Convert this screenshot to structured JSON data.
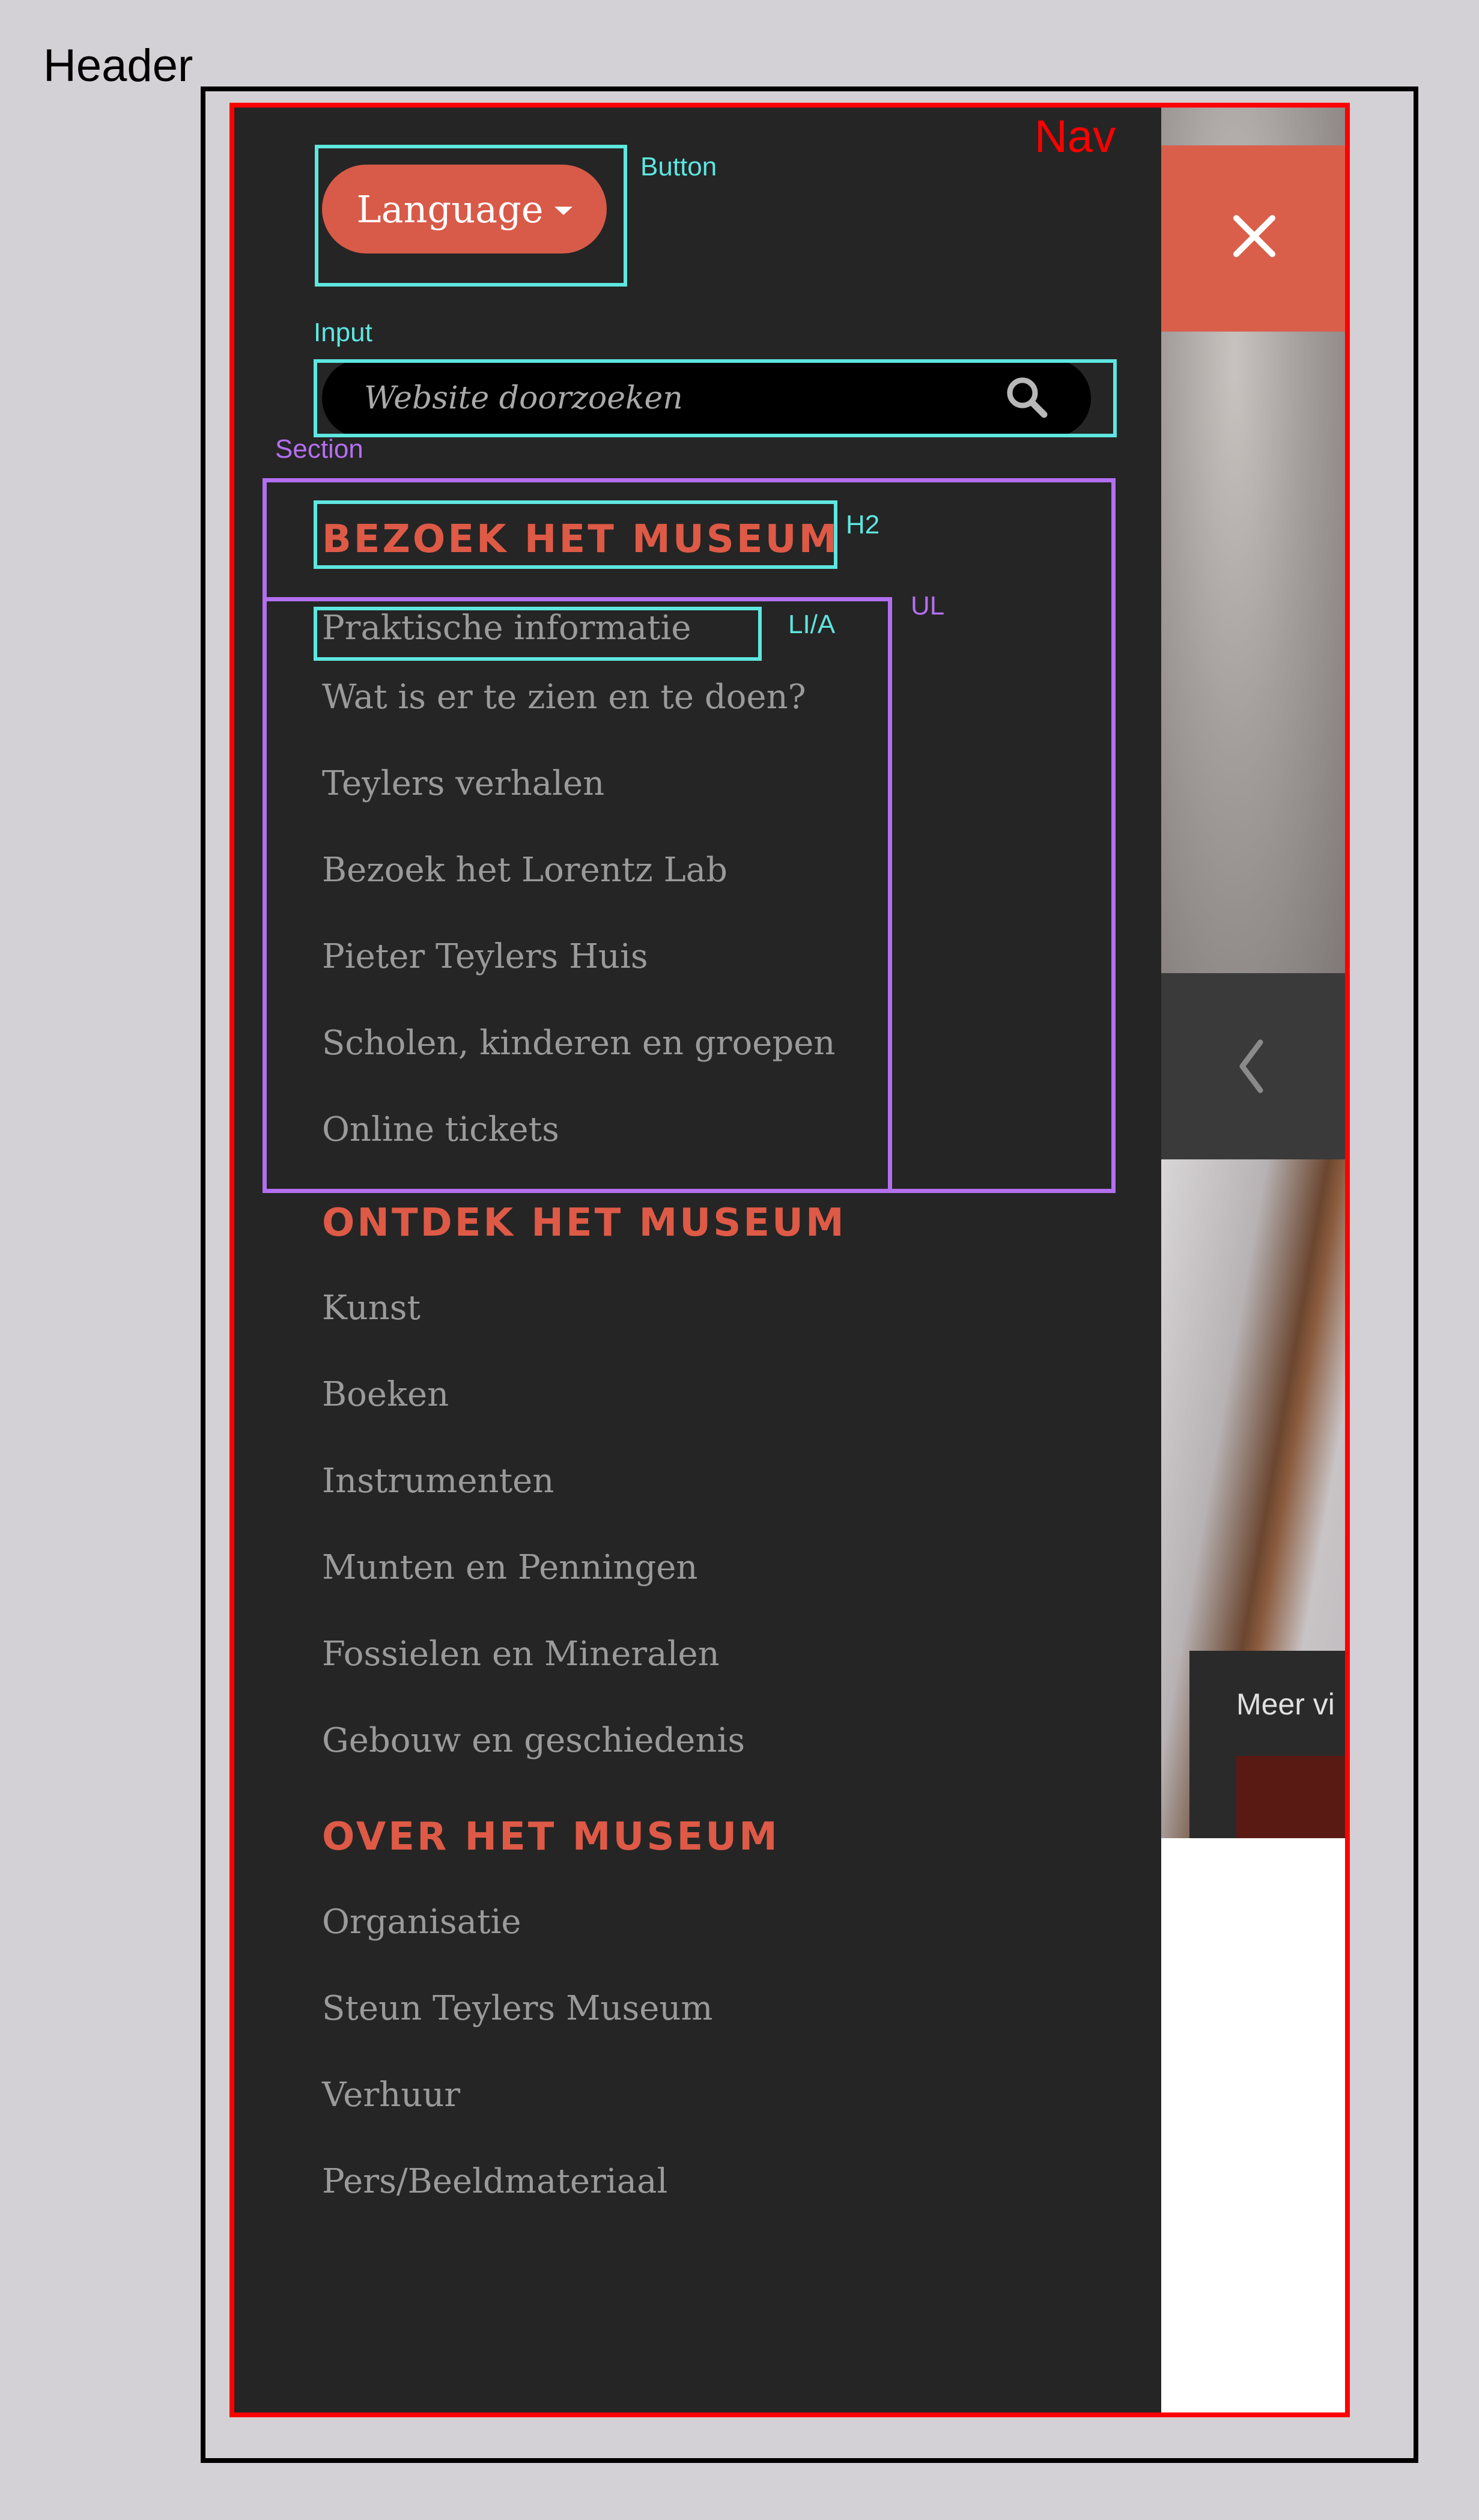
{
  "annotations": {
    "header": "Header",
    "nav": "Nav",
    "button": "Button",
    "input": "Input",
    "section": "Section",
    "h2": "H2",
    "ul": "UL",
    "li_a": "LI/A"
  },
  "language": {
    "label": "Language"
  },
  "search": {
    "placeholder": "Website doorzoeken"
  },
  "sections": [
    {
      "title": "BEZOEK HET MUSEUM",
      "items": [
        "Praktische informatie",
        "Wat is er te zien en te doen?",
        "Teylers verhalen",
        "Bezoek het Lorentz Lab",
        "Pieter Teylers Huis",
        "Scholen, kinderen en groepen",
        "Online tickets"
      ]
    },
    {
      "title": "ONTDEK HET MUSEUM",
      "items": [
        "Kunst",
        "Boeken",
        "Instrumenten",
        "Munten en Penningen",
        "Fossielen en Mineralen",
        "Gebouw en geschiedenis"
      ]
    },
    {
      "title": "OVER HET MUSEUM",
      "items": [
        "Organisatie",
        "Steun Teylers Museum",
        "Verhuur",
        "Pers/Beeldmateriaal"
      ]
    }
  ],
  "background_page": {
    "card_text": "Meer vi"
  },
  "colors": {
    "accent": "#de5a46",
    "panel": "#252525",
    "annotation_header": "#000000",
    "annotation_nav": "#ff0000",
    "annotation_element": "#5ee6e0",
    "annotation_container": "#b46ff0"
  },
  "icons": {
    "close": "close-icon",
    "search": "search-icon",
    "chevron_left": "chevron-left-icon",
    "caret": "caret-down-icon"
  }
}
